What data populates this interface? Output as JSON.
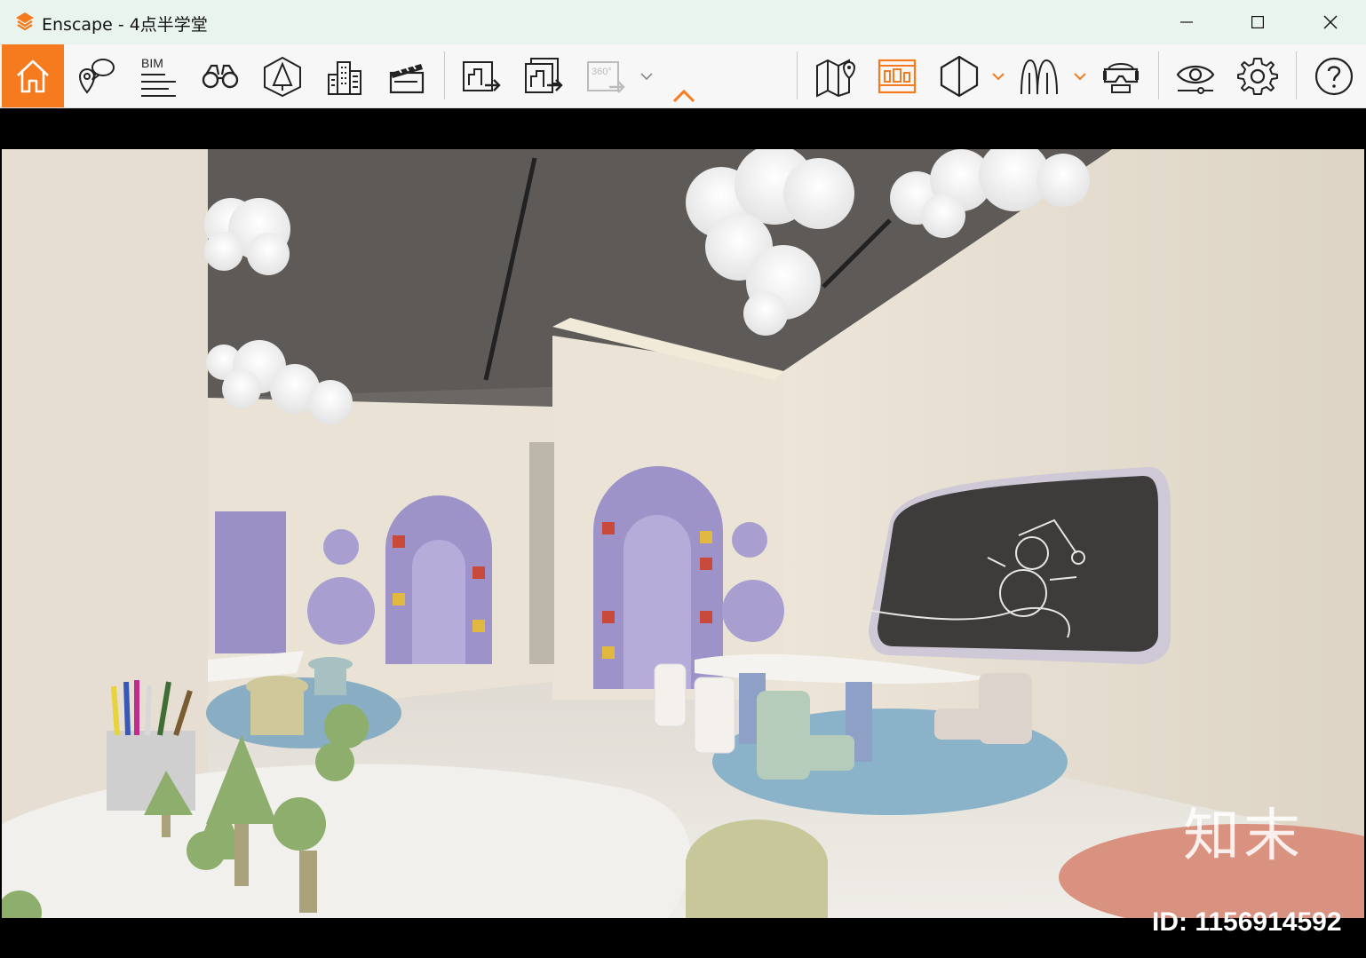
{
  "window": {
    "title": "Enscape - 4点半学堂",
    "controls": [
      "minimize",
      "maximize",
      "close"
    ]
  },
  "toolbar": {
    "buttons": [
      {
        "name": "home",
        "icon": "home-icon",
        "active": true
      },
      {
        "name": "views",
        "icon": "location-pins-icon"
      },
      {
        "name": "bim",
        "icon": "bim-icon",
        "label": "BIM"
      },
      {
        "name": "explore",
        "icon": "binoculars-icon"
      },
      {
        "name": "asset-library",
        "icon": "asset-library-icon"
      },
      {
        "name": "buildings",
        "icon": "buildings-icon"
      },
      {
        "name": "video",
        "icon": "clapperboard-icon"
      },
      {
        "name": "export-image",
        "icon": "export-image-icon"
      },
      {
        "name": "batch-export",
        "icon": "batch-export-icon"
      },
      {
        "name": "panorama",
        "icon": "panorama-360-icon",
        "label": "360°",
        "disabled": true
      },
      {
        "name": "collapse",
        "icon": "chevron-up-icon"
      },
      {
        "name": "map",
        "icon": "map-pin-icon"
      },
      {
        "name": "visual-settings-panel",
        "icon": "panel-icon",
        "active": true
      },
      {
        "name": "section",
        "icon": "section-icon"
      },
      {
        "name": "vegetation",
        "icon": "vegetation-icon"
      },
      {
        "name": "vr",
        "icon": "vr-headset-icon"
      },
      {
        "name": "visibility",
        "icon": "eye-icon"
      },
      {
        "name": "settings",
        "icon": "gear-icon"
      },
      {
        "name": "help",
        "icon": "help-icon"
      }
    ],
    "accent_color": "#f57b1e"
  },
  "viewport": {
    "scene": "Rendered kindergarten interior with cloud lamps, purple arched bookshelves, chalkboard with snowman drawing, white tables and pastel chairs",
    "watermark_logo": "知末",
    "watermark_id": "ID: 1156914592"
  }
}
